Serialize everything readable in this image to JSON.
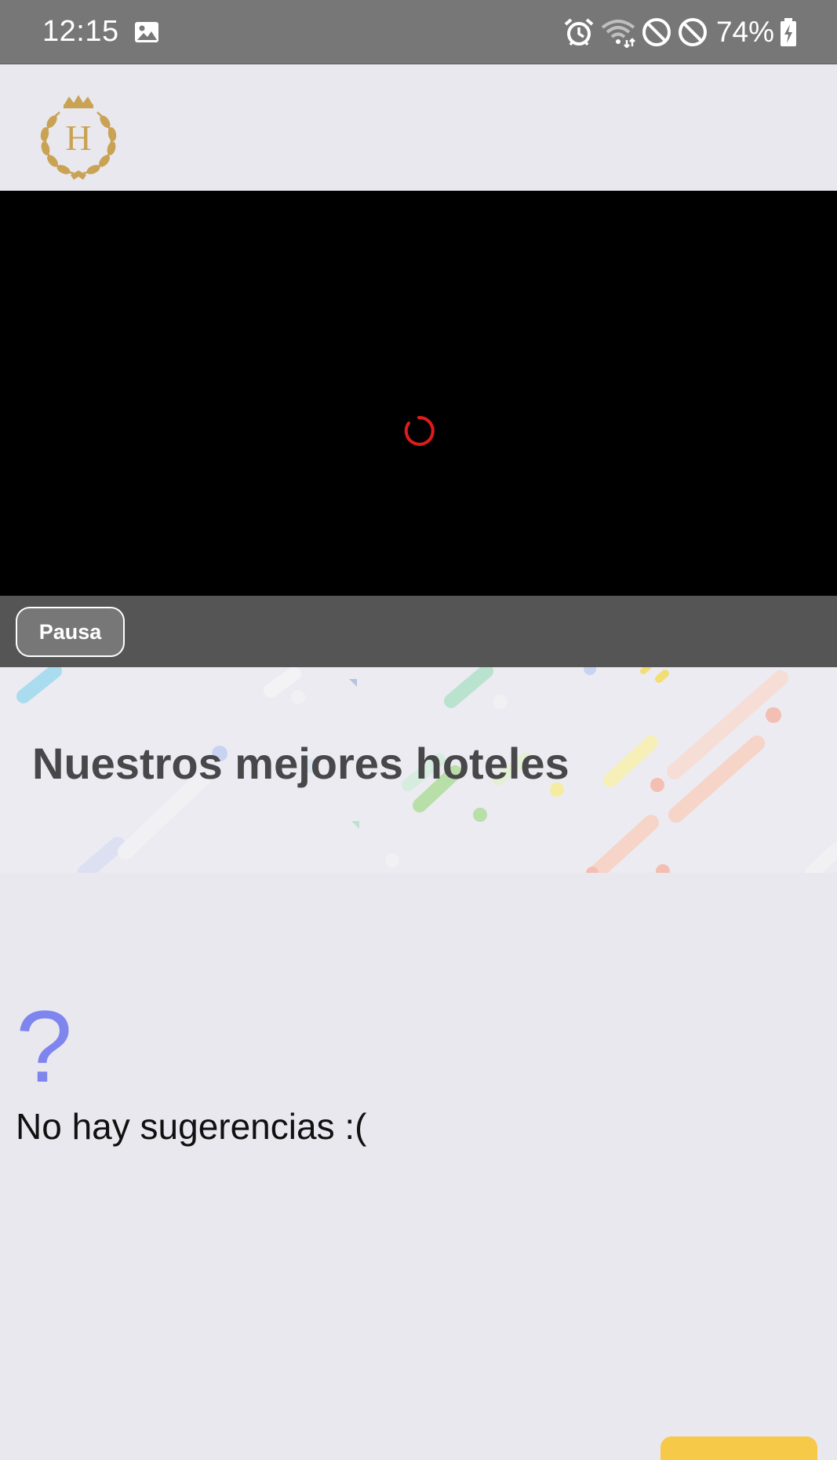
{
  "status_bar": {
    "time": "12:15",
    "battery": "74%",
    "icons": [
      "image-icon",
      "alarm-icon",
      "wifi-icon",
      "do-not-disturb-icon",
      "blocked-icon",
      "battery-charging-icon"
    ]
  },
  "header": {
    "logo_letter": "H"
  },
  "video": {
    "state": "loading",
    "spinner_color": "#e01b1b",
    "pause_label": "Pausa"
  },
  "section": {
    "title": "Nuestros mejores hoteles"
  },
  "empty_state": {
    "icon": "?",
    "message": "No hay sugerencias :("
  },
  "colors": {
    "status_bar": "#777777",
    "background": "#e9e8ef",
    "controls_bar": "#555555",
    "empty_icon": "#7f85ee",
    "logo_gold": "#c9a253"
  }
}
